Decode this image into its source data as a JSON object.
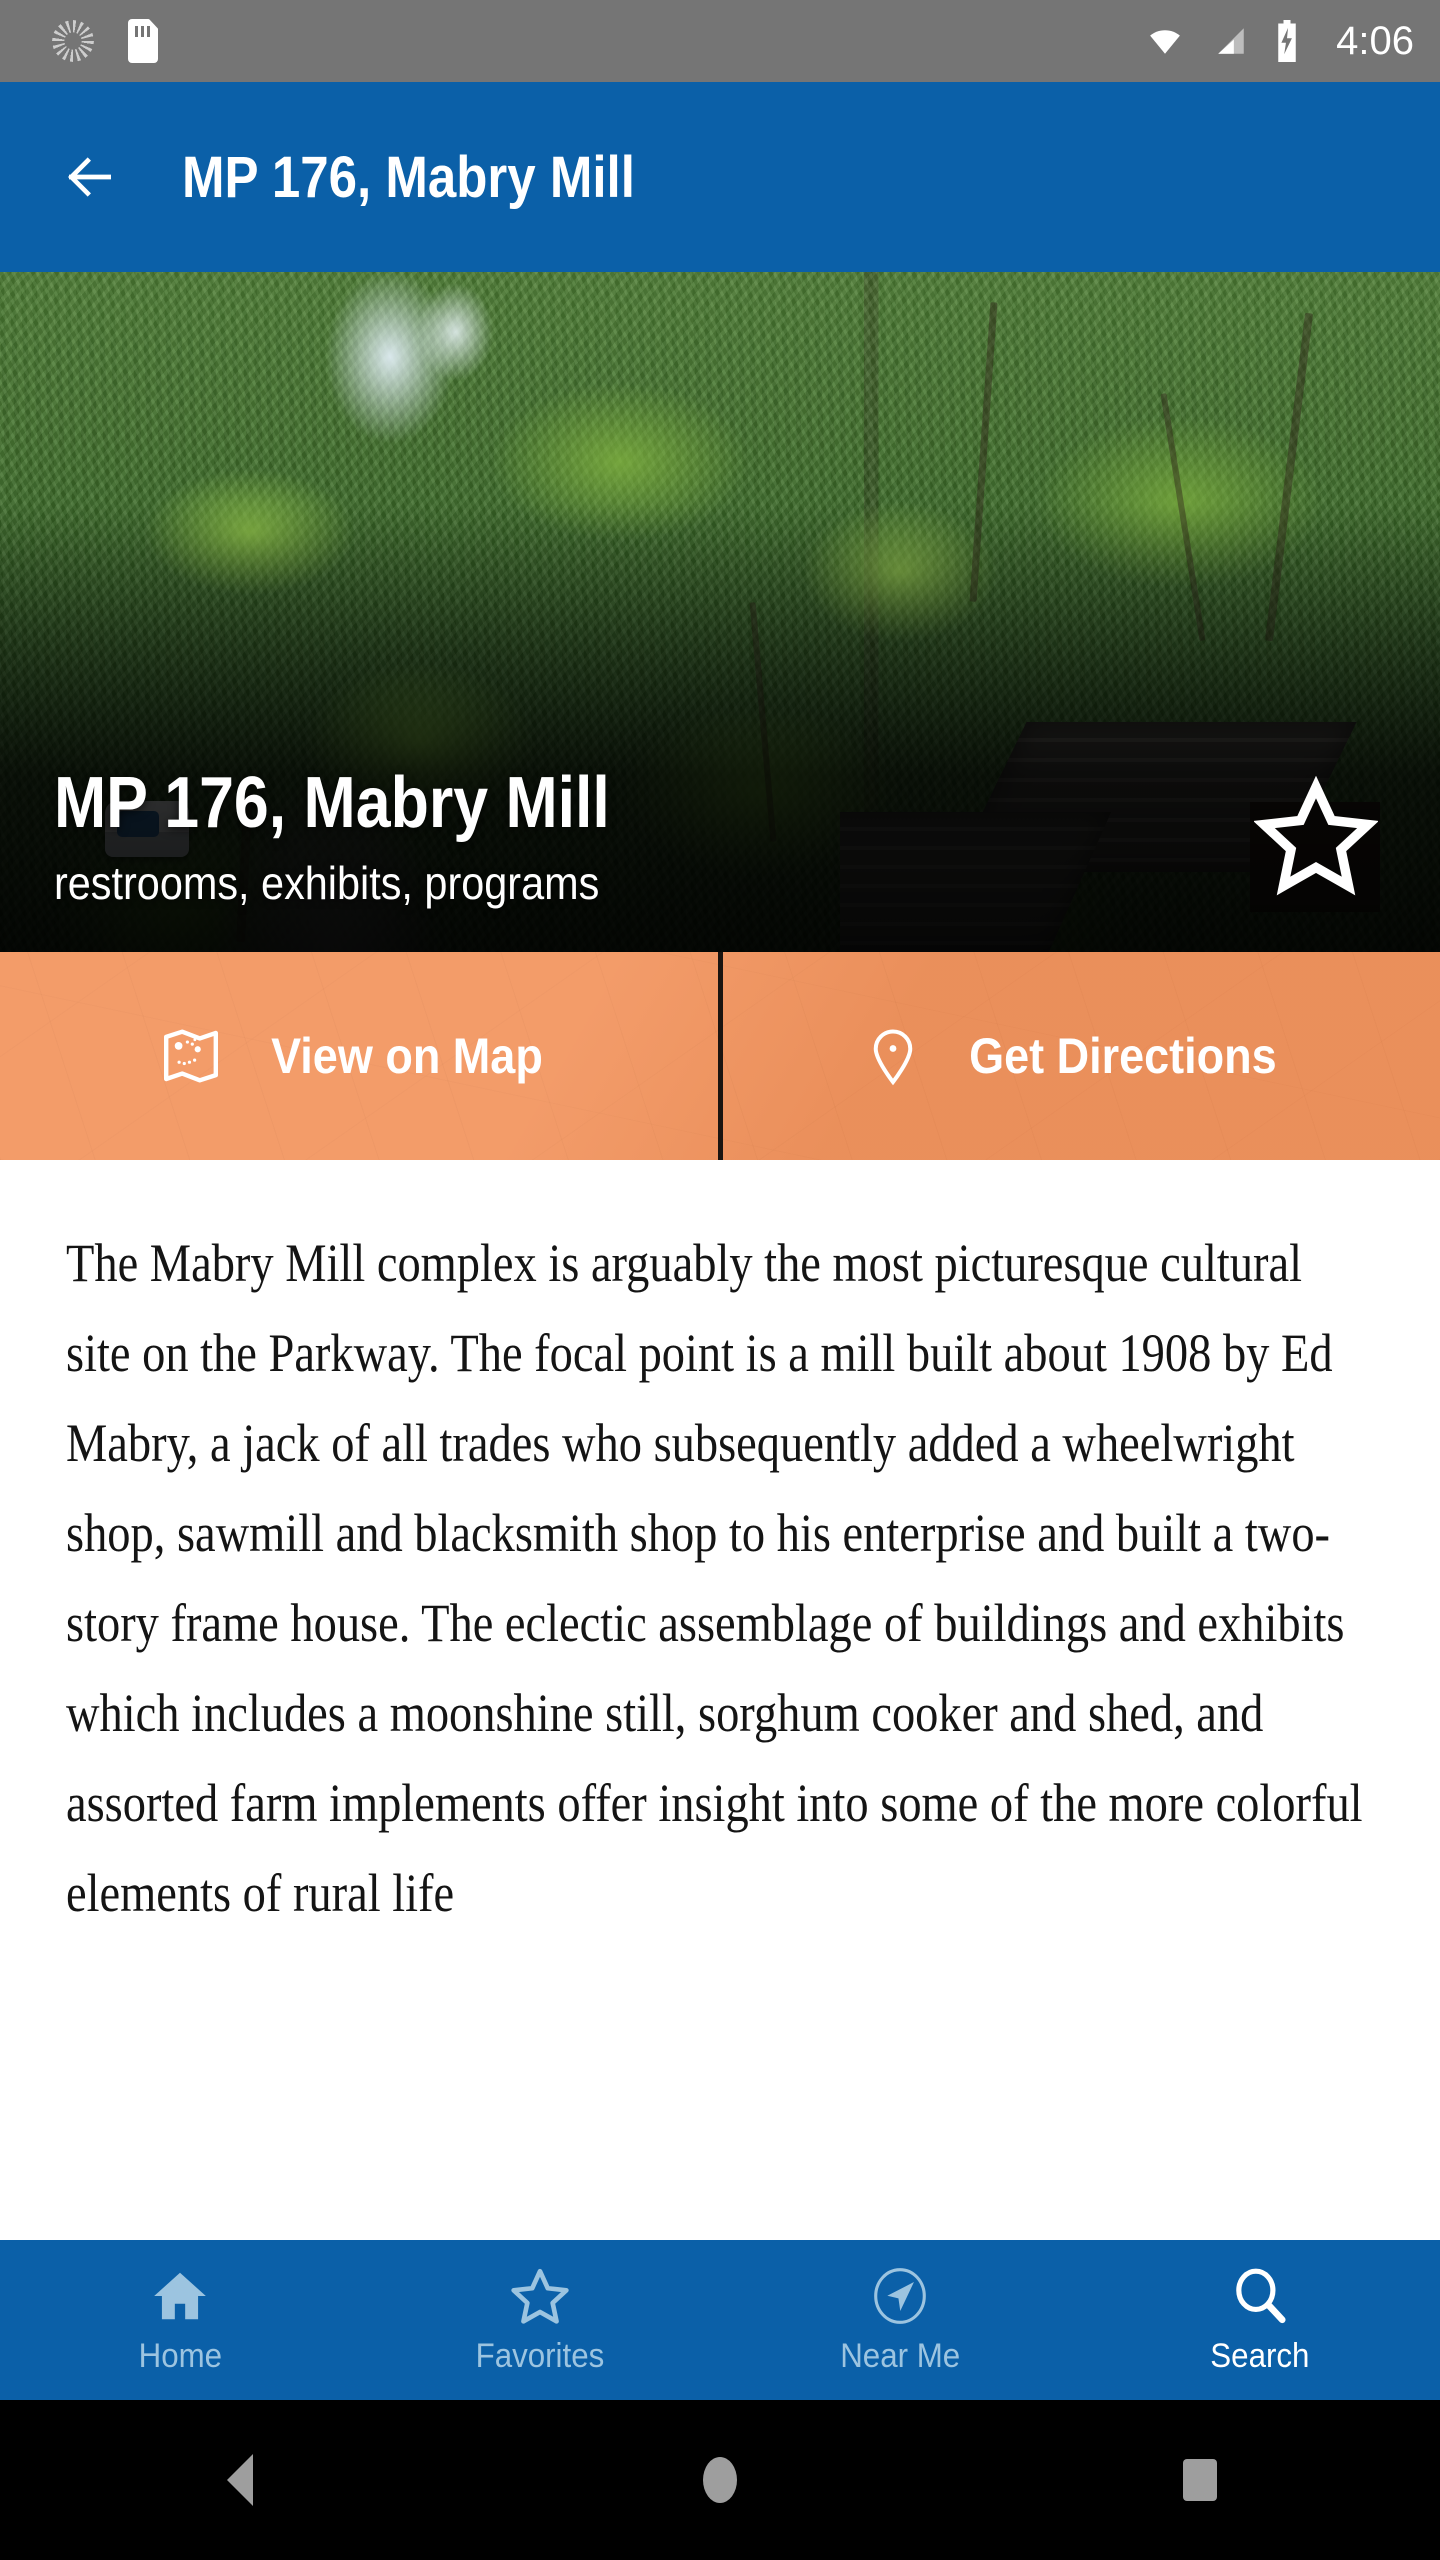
{
  "status_bar": {
    "time": "4:06",
    "icons": [
      "spinner-icon",
      "sd-card-icon",
      "wifi-icon",
      "signal-icon",
      "battery-charging-icon"
    ],
    "background": "#757575"
  },
  "app_bar": {
    "back_icon": "back-arrow-icon",
    "title": "MP 176, Mabry Mill",
    "background": "#0B60A8"
  },
  "hero": {
    "title": "MP 176, Mabry Mill",
    "subtitle": "restrooms, exhibits, programs",
    "favorite_icon": "star-outline-icon",
    "favorited": false,
    "photo_description": "Green forest canopy with winding parkway road and wooden mill buildings"
  },
  "action_bar": {
    "background": "#F2945E",
    "buttons": [
      {
        "label": "View on Map",
        "icon": "map-icon"
      },
      {
        "label": "Get Directions",
        "icon": "map-pin-icon"
      }
    ]
  },
  "content": {
    "body": "The Mabry Mill complex is arguably the most picturesque cultural site on the Parkway. The focal point is a mill built about 1908 by Ed Mabry, a jack of all trades who subsequently added a wheelwright shop, sawmill and blacksmith shop to his enterprise and built a two-story frame house. The eclectic assemblage of buildings and exhibits which includes a moonshine still, sorghum cooker and shed, and assorted farm implements offer insight into some of the more colorful elements of rural life"
  },
  "bottom_nav": {
    "background": "#0B60A8",
    "active_color": "#FFFFFF",
    "inactive_color": "#9CC4E0",
    "items": [
      {
        "label": "Home",
        "icon": "home-icon",
        "active": false
      },
      {
        "label": "Favorites",
        "icon": "star-outline-icon",
        "active": false
      },
      {
        "label": "Near Me",
        "icon": "compass-icon",
        "active": false
      },
      {
        "label": "Search",
        "icon": "search-icon",
        "active": true
      }
    ]
  },
  "android_nav": {
    "background": "#000000",
    "buttons": [
      {
        "icon": "android-back-icon"
      },
      {
        "icon": "android-home-icon"
      },
      {
        "icon": "android-recents-icon"
      }
    ]
  }
}
